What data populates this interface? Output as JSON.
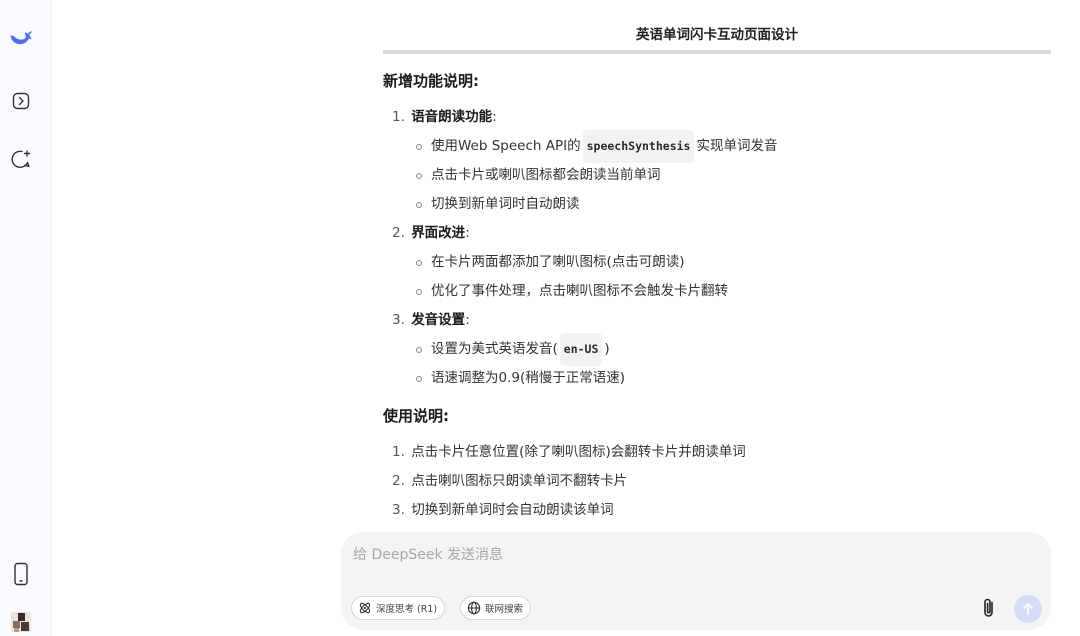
{
  "sidebar": {
    "logo_icon": "deepseek-whale-logo",
    "icons": [
      "open-sidebar-icon",
      "new-chat-icon",
      "mobile-app-icon",
      "user-avatar"
    ]
  },
  "message": {
    "title": "英语单词闪卡互动页面设计",
    "sections": [
      {
        "heading": "新增功能说明",
        "colon": ":",
        "items": [
          {
            "num": "1.",
            "label": "语音朗读功能",
            "suffix": ":",
            "subs": [
              {
                "pre": "使用Web Speech API的",
                "code": "speechSynthesis",
                "post": "实现单词发音"
              },
              {
                "pre": "点击卡片或喇叭图标都会朗读当前单词"
              },
              {
                "pre": "切换到新单词时自动朗读"
              }
            ]
          },
          {
            "num": "2.",
            "label": "界面改进",
            "suffix": ":",
            "subs": [
              {
                "pre": "在卡片两面都添加了喇叭图标(点击可朗读)"
              },
              {
                "pre": "优化了事件处理，点击喇叭图标不会触发卡片翻转"
              }
            ]
          },
          {
            "num": "3.",
            "label": "发音设置",
            "suffix": ":",
            "subs": [
              {
                "pre": "设置为美式英语发音(",
                "code": "en-US",
                "post": ")"
              },
              {
                "pre": "语速调整为0.9(稍慢于正常语速)"
              }
            ]
          }
        ]
      },
      {
        "heading": "使用说明",
        "colon": ":",
        "plain_items": [
          {
            "num": "1.",
            "text": "点击卡片任意位置(除了喇叭图标)会翻转卡片并朗读单词"
          },
          {
            "num": "2.",
            "text": "点击喇叭图标只朗读单词不翻转卡片"
          },
          {
            "num": "3.",
            "text": "切换到新单词时会自动朗读该单词"
          }
        ]
      }
    ]
  },
  "composer": {
    "placeholder": "给 DeepSeek 发送消息",
    "deep_think_label": "深度思考 (R1)",
    "web_search_label": "联网搜索",
    "attach_icon": "paperclip-icon",
    "send_icon": "arrow-up-icon"
  },
  "colors": {
    "accent": "#4d6bfe",
    "send_disabled": "#d3dcf9",
    "sidebar_bg": "#f9fbff",
    "input_bg": "#f3f4f6"
  }
}
